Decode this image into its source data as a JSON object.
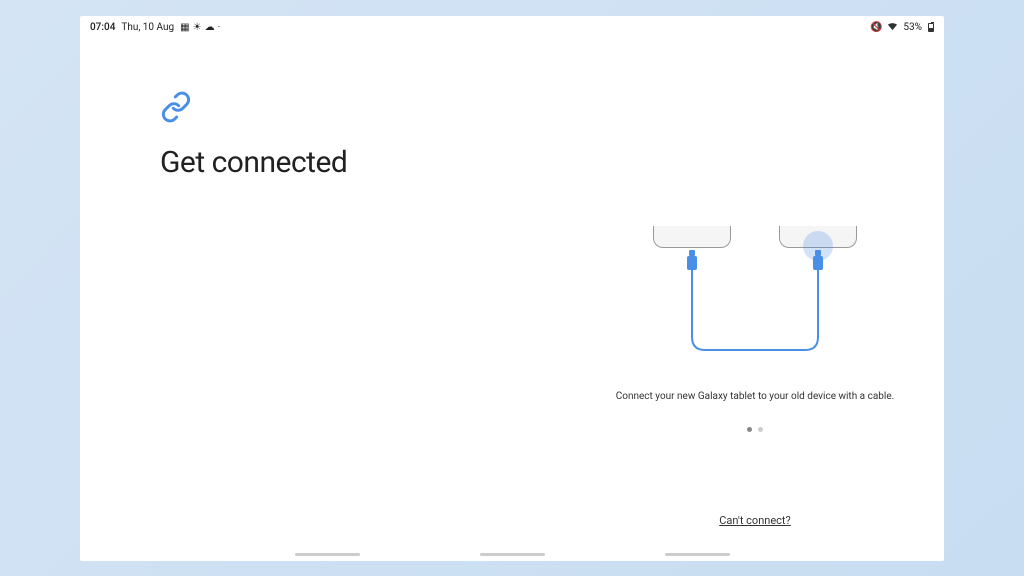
{
  "status_bar": {
    "time": "07:04",
    "date": "Thu, 10 Aug",
    "battery_pct": "53%"
  },
  "page": {
    "title": "Get connected",
    "instruction": "Connect your new Galaxy tablet to your old device with a cable.",
    "cant_connect": "Can't connect?"
  },
  "pagination": {
    "total": 2,
    "active_index": 0
  },
  "colors": {
    "accent": "#4a8fe7"
  }
}
